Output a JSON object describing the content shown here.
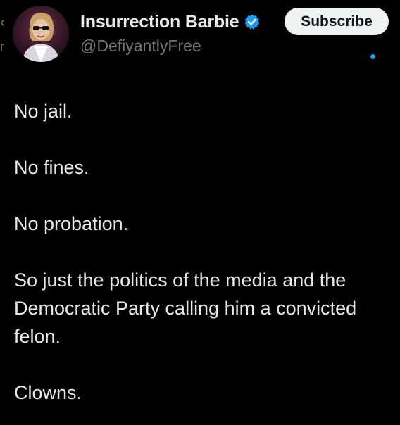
{
  "author": {
    "display_name": "Insurrection Barbie",
    "handle": "@DefiyantlyFree",
    "verified_icon": "verified-badge-icon",
    "avatar_icon": "profile-avatar"
  },
  "actions": {
    "subscribe_label": "Subscribe"
  },
  "tweet": {
    "paragraphs": [
      "No jail.",
      "No fines.",
      "No probation.",
      "So just the politics of the media and the Democratic Party calling him a convicted felon.",
      "Clowns."
    ]
  },
  "colors": {
    "background": "#000000",
    "text_primary": "#e7e9ea",
    "text_secondary": "#71767b",
    "accent_blue": "#1d9bf0",
    "button_bg": "#eff3f4"
  }
}
